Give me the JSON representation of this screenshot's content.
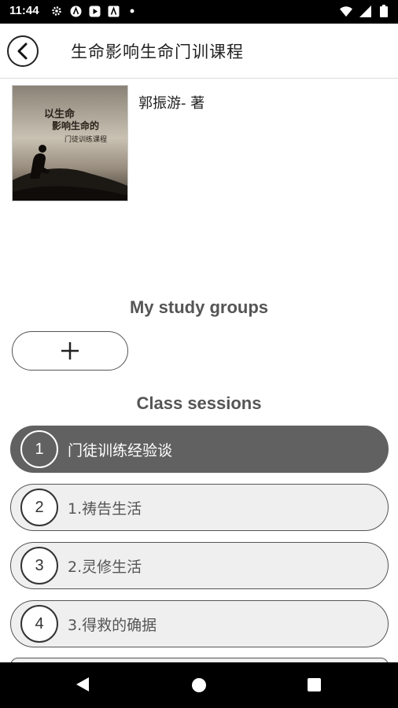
{
  "status_bar": {
    "time": "11:44",
    "icons_left": [
      "settings-icon",
      "app-a-icon",
      "play-icon",
      "app-a-icon",
      "dot-icon"
    ],
    "icons_right": [
      "wifi-icon",
      "signal-icon",
      "battery-icon"
    ]
  },
  "header": {
    "title": "生命影响生命门训课程",
    "back_icon": "chevron-left-icon"
  },
  "book": {
    "cover_lines": [
      "以生命",
      "影响生命的",
      "门徒训练课程"
    ],
    "author": "郭振游- 著"
  },
  "study_groups": {
    "title": "My study groups",
    "add_icon": "plus-icon"
  },
  "class_sessions": {
    "title": "Class sessions",
    "items": [
      {
        "number": "1",
        "label": "门徒训练经验谈",
        "active": true
      },
      {
        "number": "2",
        "label": "1.祷告生活",
        "active": false
      },
      {
        "number": "3",
        "label": "2.灵修生活",
        "active": false
      },
      {
        "number": "4",
        "label": "3.得救的确据",
        "active": false
      }
    ]
  },
  "colors": {
    "active_session": "#616161",
    "inactive_session": "#efefef",
    "heading_text": "#555555"
  }
}
